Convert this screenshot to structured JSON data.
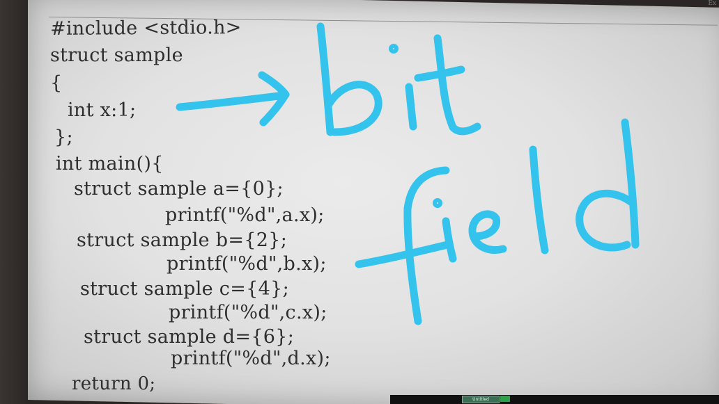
{
  "corner_label": "Ex",
  "code_lines": [
    "#include <stdio.h>",
    "struct sample",
    "{",
    "int x:1;",
    "};",
    "int main(){",
    "struct sample a={0};",
    "printf(\"%d\",a.x);",
    "struct sample b={2};",
    "printf(\"%d\",b.x);",
    "struct sample c={4};",
    "printf(\"%d\",c.x);",
    "struct sample d={6};",
    "printf(\"%d\",d.x);",
    "return 0;"
  ],
  "annotation": {
    "color": "#33c3ec",
    "word1": "bit",
    "word2": "field",
    "arrow": "right-arrow-icon"
  },
  "taskbar": {
    "button_label": "Untitled"
  }
}
